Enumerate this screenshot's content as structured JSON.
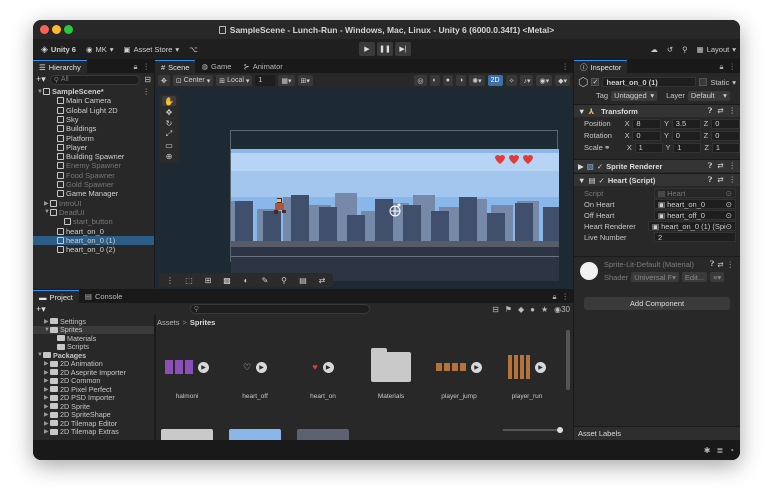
{
  "window": {
    "title": "SampleScene - Lunch-Run - Windows, Mac, Linux - Unity 6 (6000.0.34f1) <Metal>"
  },
  "toolbar": {
    "unity": "Unity 6",
    "account": "MK",
    "asset_store": "Asset Store",
    "layout": "Layout"
  },
  "hierarchy": {
    "tab": "Hierarchy",
    "search_placeholder": "All",
    "items": [
      {
        "label": "SampleScene*",
        "indent": 0,
        "bold": true,
        "dim": false
      },
      {
        "label": "Main Camera",
        "indent": 2,
        "dim": false
      },
      {
        "label": "Global Light 2D",
        "indent": 2,
        "dim": false
      },
      {
        "label": "Sky",
        "indent": 2,
        "dim": false
      },
      {
        "label": "Buildings",
        "indent": 2,
        "dim": false
      },
      {
        "label": "Platform",
        "indent": 2,
        "dim": false
      },
      {
        "label": "Player",
        "indent": 2,
        "dim": false
      },
      {
        "label": "Building Spawner",
        "indent": 2,
        "dim": false
      },
      {
        "label": "Enemy Spawner",
        "indent": 2,
        "dim": true
      },
      {
        "label": "Food Spawner",
        "indent": 2,
        "dim": true
      },
      {
        "label": "Gold Spawner",
        "indent": 2,
        "dim": true
      },
      {
        "label": "Game Manager",
        "indent": 2,
        "dim": false
      },
      {
        "label": "IntroUI",
        "indent": 1,
        "dim": true
      },
      {
        "label": "DeadUI",
        "indent": 1,
        "dim": true
      },
      {
        "label": "start_button",
        "indent": 3,
        "dim": true
      },
      {
        "label": "heart_on_0",
        "indent": 2,
        "dim": false
      },
      {
        "label": "heart_on_0 (1)",
        "indent": 2,
        "dim": false,
        "selected": true
      },
      {
        "label": "heart_on_0 (2)",
        "indent": 2,
        "dim": false
      }
    ]
  },
  "scene": {
    "tabs": [
      "Scene",
      "Game",
      "Animator"
    ],
    "pivot": "Center",
    "space": "Local",
    "grid_value": "1",
    "mode_2d": "2D"
  },
  "inspector": {
    "tab": "Inspector",
    "object_name": "heart_on_0 (1)",
    "static_label": "Static",
    "tag_label": "Tag",
    "tag": "Untagged",
    "layer_label": "Layer",
    "layer": "Default",
    "transform": {
      "title": "Transform",
      "position_label": "Position",
      "position": {
        "x": "8",
        "y": "3.5",
        "z": "0"
      },
      "rotation_label": "Rotation",
      "rotation": {
        "x": "0",
        "y": "0",
        "z": "0"
      },
      "scale_label": "Scale",
      "scale": {
        "x": "1",
        "y": "1",
        "z": "1"
      }
    },
    "sprite_renderer": "Sprite Renderer",
    "heart_script": {
      "title": "Heart (Script)",
      "script_label": "Script",
      "script": "Heart",
      "on_label": "On Heart",
      "on": "heart_on_0",
      "off_label": "Off Heart",
      "off": "heart_off_0",
      "renderer_label": "Heart Renderer",
      "renderer": "heart_on_0 (1) (Spi",
      "live_label": "Live Number",
      "live": "2"
    },
    "material": {
      "name": "Sprite-Lit-Default (Material)",
      "shader_label": "Shader",
      "shader": "Universal F",
      "edit": "Edit...",
      "menu": "≡"
    },
    "add_component": "Add Component",
    "asset_labels": "Asset Labels"
  },
  "project": {
    "tabs": [
      "Project",
      "Console"
    ],
    "count": "30",
    "breadcrumb": {
      "root": "Assets",
      "sep": ">",
      "current": "Sprites"
    },
    "tree": [
      {
        "label": "Settings",
        "indent": 1
      },
      {
        "label": "Sprites",
        "indent": 1,
        "selected": true
      },
      {
        "label": "Materials",
        "indent": 2
      },
      {
        "label": "Scripts",
        "indent": 2
      },
      {
        "label": "Packages",
        "indent": 0,
        "bold": true
      },
      {
        "label": "2D Animation",
        "indent": 1
      },
      {
        "label": "2D Aseprite Importer",
        "indent": 1
      },
      {
        "label": "2D Common",
        "indent": 1
      },
      {
        "label": "2D Pixel Perfect",
        "indent": 1
      },
      {
        "label": "2D PSD Importer",
        "indent": 1
      },
      {
        "label": "2D Sprite",
        "indent": 1
      },
      {
        "label": "2D SpriteShape",
        "indent": 1
      },
      {
        "label": "2D Tilemap Editor",
        "indent": 1
      },
      {
        "label": "2D Tilemap Extras",
        "indent": 1
      }
    ],
    "assets": [
      "halmoni",
      "heart_off",
      "heart_on",
      "Materials",
      "player_jump",
      "player_run"
    ]
  },
  "colors": {
    "accent": "#3a8ff0",
    "selected_row": "#2c5d87",
    "heart": "#e03a3a",
    "sky": "#89b7ea"
  }
}
